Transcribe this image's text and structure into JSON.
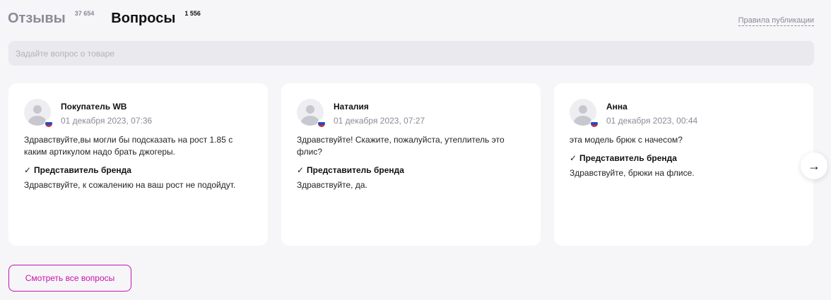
{
  "tabs": [
    {
      "label": "Отзывы",
      "count": "37 654",
      "active": false
    },
    {
      "label": "Вопросы",
      "count": "1 556",
      "active": true
    }
  ],
  "rules_link": "Правила публикации",
  "ask_input": {
    "placeholder": "Задайте вопрос о товаре",
    "value": ""
  },
  "questions": [
    {
      "author": "Покупатель WB",
      "date": "01 декабря 2023, 07:36",
      "text": "Здравствуйте,вы могли бы подсказать на рост 1.85 с каким артикулом надо брать джогеры.",
      "answer_author": "Представитель бренда",
      "answer_text": "Здравствуйте, к сожалению на ваш рост не подойдут."
    },
    {
      "author": "Наталия",
      "date": "01 декабря 2023, 07:27",
      "text": "Здравствуйте! Скажите, пожалуйста, утеплитель это флис?",
      "answer_author": "Представитель бренда",
      "answer_text": "Здравствуйте, да."
    },
    {
      "author": "Анна",
      "date": "01 декабря 2023, 00:44",
      "text": "эта модель брюк с начесом?",
      "answer_author": "Представитель бренда",
      "answer_text": "Здравствуйте, брюки на флисе."
    }
  ],
  "icons": {
    "answer_check": "check-icon",
    "next": "arrow-right-icon",
    "avatar": "user-avatar-icon",
    "flag": "russia-flag-icon"
  },
  "colors": {
    "accent": "#cb11ab",
    "muted": "#8b8a97",
    "background": "#f6f6f9",
    "card": "#ffffff",
    "input_bg": "#e9e9ee"
  },
  "show_all_button": "Смотреть все вопросы"
}
